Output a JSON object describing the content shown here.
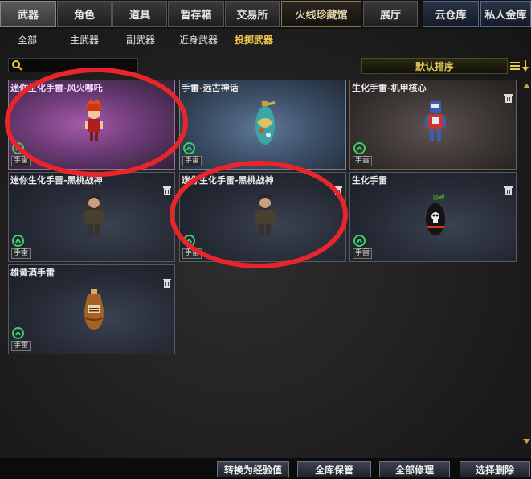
{
  "top_tabs": [
    {
      "label": "武器",
      "active": true
    },
    {
      "label": "角色"
    },
    {
      "label": "道具"
    },
    {
      "label": "暂存箱"
    },
    {
      "label": "交易所"
    },
    {
      "label": "火线珍藏馆"
    },
    {
      "label": "展厅"
    },
    {
      "label": "云仓库"
    },
    {
      "label": "私人金库"
    }
  ],
  "sub_tabs": [
    {
      "label": "全部"
    },
    {
      "label": "主武器"
    },
    {
      "label": "副武器"
    },
    {
      "label": "近身武器"
    },
    {
      "label": "投掷武器",
      "active": true
    }
  ],
  "search": {
    "placeholder": "",
    "value": ""
  },
  "sort": {
    "label": "默认排序"
  },
  "items": [
    {
      "name": "迷你生化手雷-风火哪吒",
      "type": "手雷",
      "theme": "pink",
      "figure": "red-hair-character",
      "circled": true
    },
    {
      "name": "手雷-远古神话",
      "type": "手雷",
      "theme": "aqua",
      "figure": "ornate-grenade"
    },
    {
      "name": "生化手雷-机甲核心",
      "type": "手雷",
      "theme": "brown",
      "figure": "robot-character"
    },
    {
      "name": "迷你生化手雷-黑桃战神",
      "type": "手雷",
      "theme": "blue",
      "figure": "soldier-character"
    },
    {
      "name": "迷你生化手雷-黑桃战神",
      "type": "手雷",
      "theme": "blue",
      "figure": "soldier-character",
      "circled": true
    },
    {
      "name": "生化手雷",
      "type": "手雷",
      "theme": "blue",
      "figure": "skull-grenade"
    },
    {
      "name": "雄黄酒手雷",
      "type": "手雷",
      "theme": "blue",
      "figure": "wine-jar-grenade"
    }
  ],
  "bottom_buttons": [
    {
      "label": "转换为经验值"
    },
    {
      "label": "全库保管"
    },
    {
      "label": "全部修理"
    },
    {
      "label": "选择删除"
    }
  ],
  "colors": {
    "accent": "#f2c64a",
    "annotation": "#e8252a"
  }
}
